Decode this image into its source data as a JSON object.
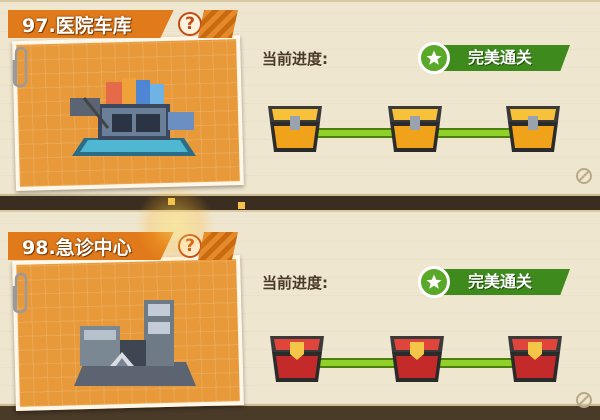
{
  "colors": {
    "title_tag": "#e07a1a",
    "badge_green": "#3f8a1c",
    "track_green": "#8fd12a",
    "gold_chest": "#f0a21a",
    "red_chest": "#c52a2a"
  },
  "levels": [
    {
      "title": "97.医院车库",
      "help": "?",
      "progress_label": "当前进度:",
      "status": "完美通关",
      "chest_style": "gold",
      "chest_icons": [
        "gold-chest-icon",
        "gold-chest-icon",
        "gold-chest-icon"
      ],
      "building_icon": "garage-building-icon"
    },
    {
      "title": "98.急诊中心",
      "help": "?",
      "progress_label": "当前进度:",
      "status": "完美通关",
      "chest_style": "red",
      "chest_icons": [
        "red-chest-icon",
        "red-chest-icon",
        "red-chest-icon"
      ],
      "building_icon": "emergency-center-building-icon"
    }
  ]
}
